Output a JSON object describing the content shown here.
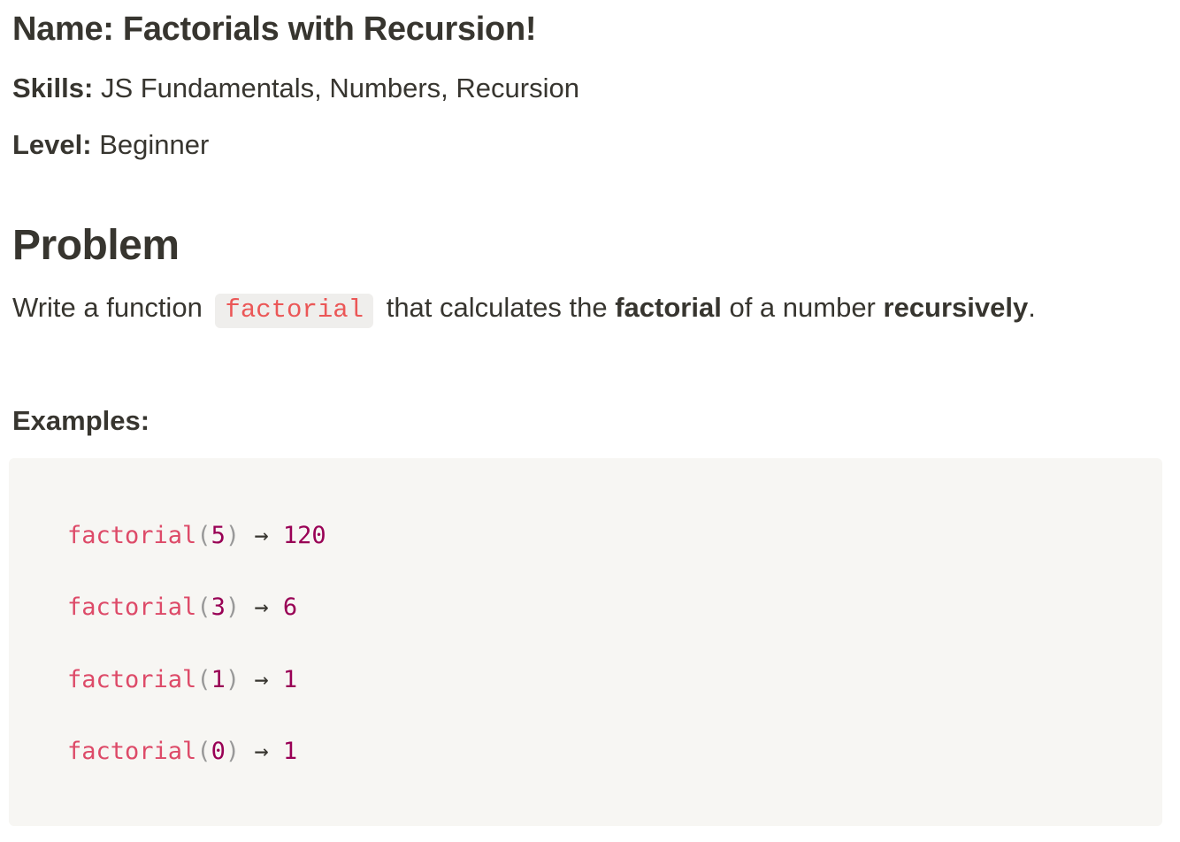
{
  "header": {
    "name_label": "Name:",
    "name_value": "Factorials with Recursion!",
    "skills_label": "Skills:",
    "skills_value": "JS Fundamentals, Numbers, Recursion",
    "level_label": "Level:",
    "level_value": "Beginner"
  },
  "problem": {
    "heading": "Problem",
    "text_before_code": "Write a function",
    "inline_code": "factorial",
    "text_after_code": "that calculates the",
    "bold_term_1": "factorial",
    "text_middle": "of a number",
    "bold_term_2": "recursively",
    "text_end": "."
  },
  "examples": {
    "heading": "Examples:",
    "lines": [
      {
        "fn": "factorial",
        "open": "(",
        "arg": "5",
        "close": ")",
        "arrow": "→",
        "result": "120"
      },
      {
        "fn": "factorial",
        "open": "(",
        "arg": "3",
        "close": ")",
        "arrow": "→",
        "result": "6"
      },
      {
        "fn": "factorial",
        "open": "(",
        "arg": "1",
        "close": ")",
        "arrow": "→",
        "result": "1"
      },
      {
        "fn": "factorial",
        "open": "(",
        "arg": "0",
        "close": ")",
        "arrow": "→",
        "result": "1"
      }
    ]
  },
  "colors": {
    "text": "#37352f",
    "inline_code_text": "#eb5757",
    "inline_code_bg": "#efeeec",
    "code_block_bg": "#f7f6f3",
    "code_function": "#dd4a68",
    "code_number": "#990055",
    "code_punctuation": "#999999"
  }
}
